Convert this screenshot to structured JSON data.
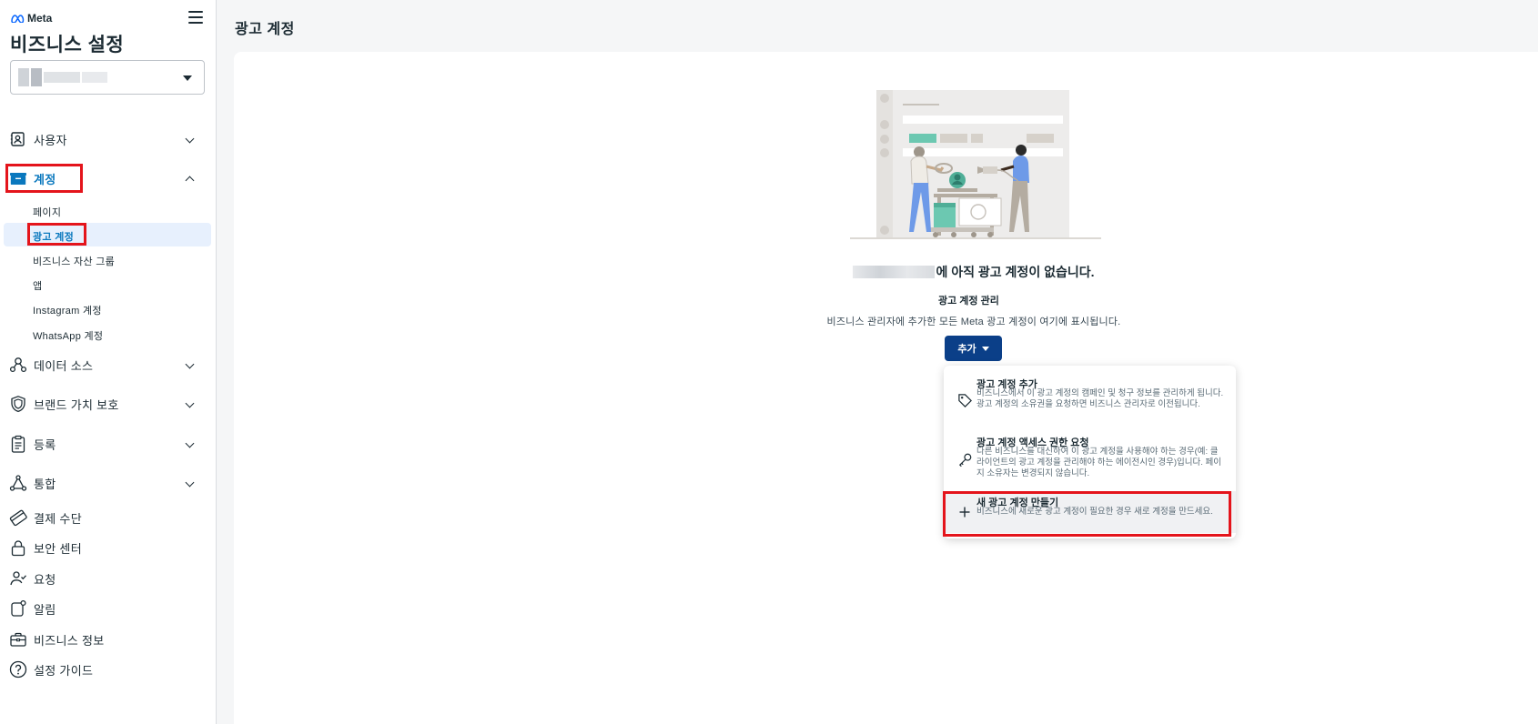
{
  "brand": {
    "logo_text": "Meta"
  },
  "app": {
    "title": "비즈니스 설정"
  },
  "sidebar": {
    "nav": [
      {
        "id": "users",
        "label": "사용자",
        "icon": "users-id-icon",
        "expanded": false
      },
      {
        "id": "accounts",
        "label": "계정",
        "icon": "folder-icon",
        "expanded": true
      },
      {
        "id": "data-sources",
        "label": "데이터 소스",
        "icon": "data-sources-icon",
        "expanded": false
      },
      {
        "id": "brand-safety",
        "label": "브랜드 가치 보호",
        "icon": "shield-icon",
        "expanded": false
      },
      {
        "id": "registrations",
        "label": "등록",
        "icon": "clipboard-icon",
        "expanded": false
      },
      {
        "id": "integrations",
        "label": "통합",
        "icon": "integrations-icon",
        "expanded": false
      },
      {
        "id": "payment-methods",
        "label": "결제 수단",
        "icon": "credit-card-icon"
      },
      {
        "id": "security-center",
        "label": "보안 센터",
        "icon": "lock-icon"
      },
      {
        "id": "requests",
        "label": "요청",
        "icon": "user-check-icon"
      },
      {
        "id": "notifications",
        "label": "알림",
        "icon": "bell-icon"
      },
      {
        "id": "business-info",
        "label": "비즈니스 정보",
        "icon": "briefcase-icon"
      },
      {
        "id": "setup-guide",
        "label": "설정 가이드",
        "icon": "help-circle-icon"
      }
    ],
    "accounts_sub": [
      {
        "id": "pages",
        "label": "페이지"
      },
      {
        "id": "ad-accounts",
        "label": "광고 계정",
        "active": true
      },
      {
        "id": "asset-groups",
        "label": "비즈니스 자산 그룹"
      },
      {
        "id": "apps",
        "label": "앱"
      },
      {
        "id": "instagram",
        "label": "Instagram 계정"
      },
      {
        "id": "whatsapp",
        "label": "WhatsApp 계정"
      }
    ]
  },
  "main": {
    "page_title": "광고 계정",
    "empty_state": {
      "title_suffix": "에 아직 광고 계정이 없습니다.",
      "manage_label": "광고 계정 관리",
      "manage_desc": "비즈니스 관리자에 추가한 모든 Meta 광고 계정이 여기에 표시됩니다."
    },
    "add_button": {
      "label": "추가"
    },
    "add_menu": [
      {
        "id": "add-ad-account",
        "title": "광고 계정 추가",
        "desc": "비즈니스에서 이 광고 계정의 캠페인 및 청구 정보를 관리하게 됩니다. 광고 계정의 소유권을 요청하면 비즈니스 관리자로 이전됩니다.",
        "icon": "tag-icon"
      },
      {
        "id": "request-access",
        "title": "광고 계정 액세스 권한 요청",
        "desc": "다른 비즈니스를 대신하여 이 광고 계정을 사용해야 하는 경우(예: 클라이언트의 광고 계정을 관리해야 하는 에이전시인 경우)입니다. 페이지 소유자는 변경되지 않습니다.",
        "icon": "key-icon"
      },
      {
        "id": "create-ad-account",
        "title": "새 광고 계정 만들기",
        "desc": "비즈니스에 새로운 광고 계정이 필요한 경우 새로 계정을 만드세요.",
        "icon": "plus-icon"
      }
    ]
  },
  "colors": {
    "accent_blue": "#0a78be",
    "button_blue": "#0b3f88",
    "highlight_red": "#e4141b",
    "selected_bg": "#e7f0fd"
  }
}
